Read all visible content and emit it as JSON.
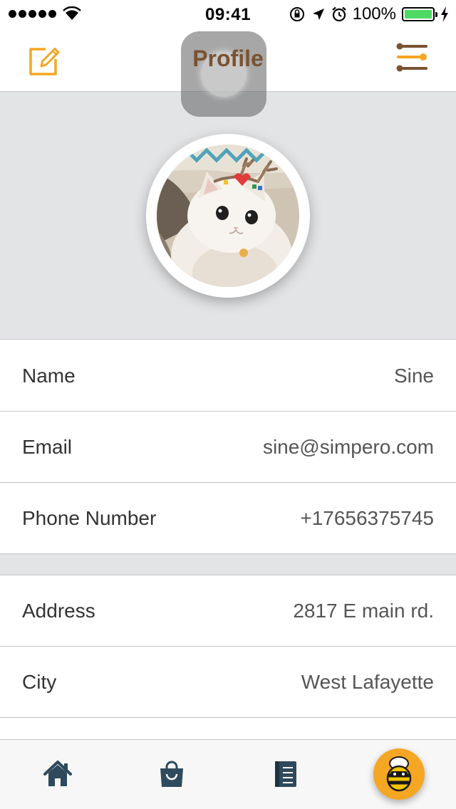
{
  "status_bar": {
    "time": "09:41",
    "battery_percent": "100%",
    "battery_level": 1.0,
    "signal_icon": "signal-dots-icon",
    "wifi_icon": "wifi-icon",
    "lock_icon": "rotation-lock-icon",
    "location_icon": "location-arrow-icon",
    "alarm_icon": "alarm-clock-icon",
    "charging_icon": "charging-bolt-icon"
  },
  "nav": {
    "title": "Profile",
    "left_icon": "edit-icon",
    "right_icon": "settings-sliders-icon",
    "accent_color": "#f5a623",
    "brown_color": "#7a5230"
  },
  "profile": {
    "avatar": "profile-photo-cat"
  },
  "info_rows": [
    {
      "label": "Name",
      "value": "Sine"
    },
    {
      "label": "Email",
      "value": "sine@simpero.com"
    },
    {
      "label": "Phone Number",
      "value": "+17656375745"
    },
    {
      "label": "Address",
      "value": "2817 E main rd."
    },
    {
      "label": "City",
      "value": "West Lafayette"
    }
  ],
  "tab_bar": {
    "items": [
      {
        "icon": "home-icon"
      },
      {
        "icon": "shopping-bag-icon"
      },
      {
        "icon": "notebook-icon"
      },
      {
        "icon": "bee-icon",
        "selected": true
      }
    ],
    "icon_color": "#2e4a5c",
    "active_color": "#f5a623"
  }
}
